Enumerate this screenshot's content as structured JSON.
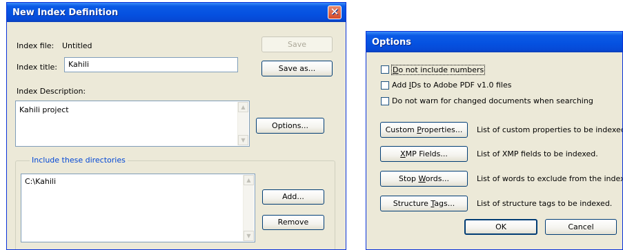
{
  "index_dialog": {
    "title": "New Index Definition",
    "close_glyph": "✕",
    "index_file_label": "Index file:",
    "index_file_value": "Untitled",
    "index_title_label": "Index title:",
    "index_title_value": "Kahili",
    "description_label": "Index Description:",
    "description_value": "Kahili project",
    "directories_group_label": "Include these directories",
    "directories": [
      "C:\\Kahili"
    ],
    "save_label": "Save",
    "save_as_label": "Save as...",
    "options_label": "Options...",
    "add_label": "Add...",
    "remove_label": "Remove"
  },
  "options_dialog": {
    "title": "Options",
    "checkboxes": [
      {
        "accel": "D",
        "rest": "o not include numbers",
        "checked": false
      },
      {
        "pre": "Add ",
        "accel": "I",
        "rest": "Ds to Adobe PDF v1.0 files",
        "checked": false
      },
      {
        "label": "Do not warn for changed documents when searching",
        "checked": false
      }
    ],
    "rows": [
      {
        "pre": "Custom ",
        "accel": "P",
        "rest": "roperties...",
        "desc": "List of custom properties to be indexed."
      },
      {
        "pre": "",
        "accel": "X",
        "rest": "MP Fields...",
        "desc": "List of XMP fields to be indexed."
      },
      {
        "pre": "Stop ",
        "accel": "W",
        "rest": "ords...",
        "desc": "List of words to exclude from the index."
      },
      {
        "pre": "Structure ",
        "accel": "T",
        "rest": "ags...",
        "desc": "List of structure tags to be indexed."
      }
    ],
    "ok_label": "OK",
    "cancel_label": "Cancel"
  },
  "colors": {
    "titlebar": "#0551e0",
    "dialog_bg": "#ece9d8",
    "button_border": "#003c74",
    "group_label": "#0046d5"
  }
}
